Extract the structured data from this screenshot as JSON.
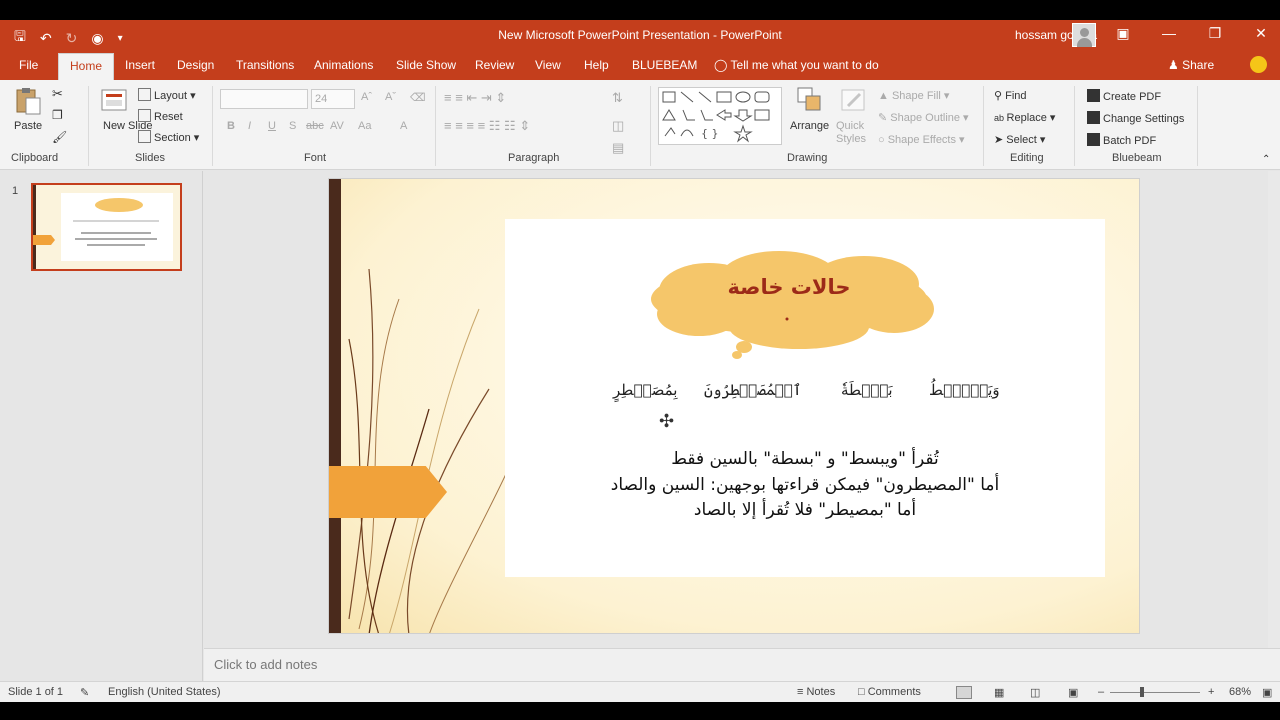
{
  "window": {
    "title": "New Microsoft PowerPoint Presentation  -  PowerPoint",
    "user": "hossam gomaa"
  },
  "tabs": [
    "File",
    "Home",
    "Insert",
    "Design",
    "Transitions",
    "Animations",
    "Slide Show",
    "Review",
    "View",
    "Help",
    "BLUEBEAM"
  ],
  "tell_me": "Tell me what you want to do",
  "share": "Share",
  "ribbon": {
    "clipboard": {
      "label": "Clipboard",
      "paste": "Paste"
    },
    "slides": {
      "label": "Slides",
      "new_slide": "New Slide",
      "layout": "Layout",
      "reset": "Reset",
      "section": "Section"
    },
    "font": {
      "label": "Font",
      "size": "24",
      "bold": "B",
      "italic": "I",
      "underline": "U",
      "strike": "S",
      "spacing": "abc",
      "case": "Aa",
      "color": "A"
    },
    "paragraph": {
      "label": "Paragraph"
    },
    "drawing": {
      "label": "Drawing",
      "arrange": "Arrange",
      "quick_styles": "Quick Styles",
      "shape_fill": "Shape Fill",
      "shape_outline": "Shape Outline",
      "shape_effects": "Shape Effects"
    },
    "editing": {
      "label": "Editing",
      "find": "Find",
      "replace": "Replace",
      "select": "Select"
    },
    "bluebeam": {
      "label": "Bluebeam",
      "create_pdf": "Create PDF",
      "change_settings": "Change Settings",
      "batch_pdf": "Batch PDF"
    }
  },
  "thumbnail": {
    "number": "1"
  },
  "slide": {
    "cloud_title": "حالات خاصة",
    "words": [
      "وَيَبۡصُۜطُ",
      "بَصۜۜطَةٗ",
      "ٱلۡمُصَيۡطِرُونَ",
      "بِمُصَيۡطِرٍ"
    ],
    "lines": [
      "تُقرأ \"ويبسط\" و \"بسطة\" بالسين فقط",
      "أما \"المصيطرون\" فيمكن قراءتها بوجهين: السين والصاد",
      "أما \"بمصيطر\" فلا تُقرأ إلا بالصاد"
    ]
  },
  "notes_placeholder": "Click to add notes",
  "status": {
    "slide_count": "Slide 1 of 1",
    "language": "English (United States)",
    "notes": "Notes",
    "comments": "Comments",
    "zoom": "68%"
  },
  "colors": {
    "accent": "#c43e1c",
    "cloud": "#f5c66a",
    "arrow": "#f1a23a",
    "dark_bar": "#4a2a1c"
  }
}
